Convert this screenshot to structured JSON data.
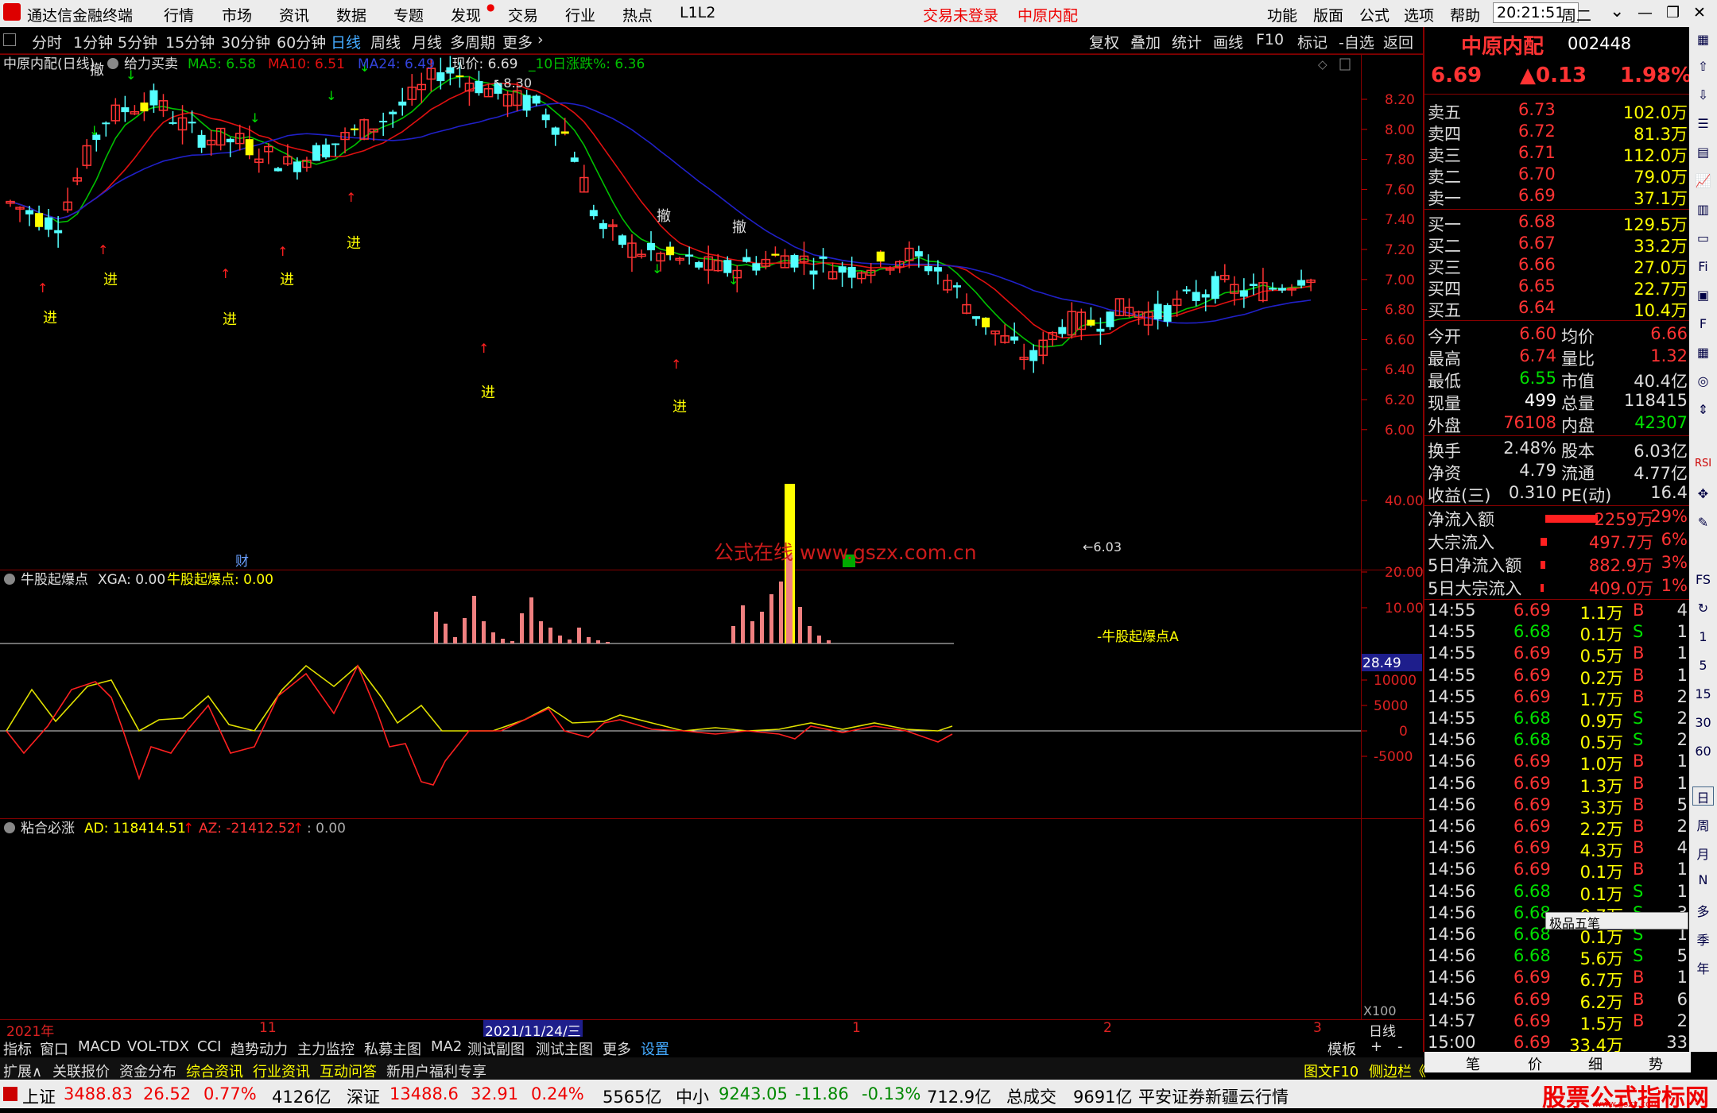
{
  "titlebar": {
    "app_name": "通达信金融终端",
    "menus": [
      "行情",
      "市场",
      "资讯",
      "数据",
      "专题",
      "发现",
      "交易",
      "行业",
      "热点",
      "L1L2"
    ],
    "trade_status": "交易未登录",
    "stock_name": "中原内配",
    "right_menus": [
      "功能",
      "版面",
      "公式",
      "选项",
      "帮助"
    ],
    "time": "20:21:51",
    "weekday": "周二"
  },
  "tfbar": {
    "timeframes": [
      "分时",
      "1分钟",
      "5分钟",
      "15分钟",
      "30分钟",
      "60分钟",
      "日线",
      "周线",
      "月线",
      "多周期",
      "更多"
    ],
    "active": "日线",
    "tools": [
      "复权",
      "叠加",
      "统计",
      "画线",
      "F10",
      "标记",
      "-自选",
      "返回"
    ]
  },
  "chart_header": {
    "name": "中原内配(日线)",
    "mode": "给力买卖",
    "ma5": "MA5: 6.58",
    "ma10": "MA10: 6.51",
    "ma24": "MA24: 6.49",
    "price": "_现价: 6.69",
    "pct": "_10日涨跌%: 6.36"
  },
  "main_chart": {
    "y_ticks": [
      "8.20",
      "8.00",
      "7.80",
      "7.60",
      "7.40",
      "7.20",
      "7.00",
      "6.80",
      "6.60",
      "6.40",
      "6.20",
      "6.00"
    ],
    "high_label": "8.30",
    "low_label": "6.03",
    "signal_buy": "进",
    "signal_cancel": "撤",
    "event_cai": "财",
    "watermark": "公式在线 www.gszx.com.cn"
  },
  "sub1": {
    "title": "牛股起爆点",
    "xga": "XGA: 0.00",
    "value": "牛股起爆点: 0.00",
    "y_ticks": [
      "40.00",
      "20.00",
      "10.00"
    ],
    "cursor_value": "28.49",
    "annotation": "牛股起爆点A"
  },
  "sub2": {
    "title": "粘合必涨",
    "ad": "AD: 118414.51",
    "az": "AZ: -21412.52",
    "zero": ": 0.00",
    "y_ticks": [
      "10000",
      "5000",
      "0",
      "-5000"
    ],
    "scale": "X100"
  },
  "time_axis": {
    "labels": [
      "2021年",
      "11",
      "2021/11/24/三",
      "1",
      "2",
      "3"
    ],
    "period": "日线"
  },
  "bottomtabs": [
    "指标",
    "窗口",
    "MACD",
    "VOL-TDX",
    "CCI",
    "趋势动力",
    "主力监控",
    "私募主图",
    "MA2",
    "测试副图",
    "测试主图",
    "更多",
    "设置"
  ],
  "bottomtabs_right": [
    "模板",
    "+",
    "-"
  ],
  "extbar": {
    "items": [
      "扩展∧",
      "关联报价",
      "资金分布",
      "综合资讯",
      "行业资讯",
      "互动问答",
      "新用户福利专享"
    ],
    "right": [
      "图文F10",
      "侧边栏《",
      "笔",
      "价",
      "细",
      "势"
    ]
  },
  "quote": {
    "name": "中原内配",
    "code": "002448",
    "price": "6.69",
    "change": "▲0.13",
    "pct": "1.98%",
    "sell": [
      [
        "卖五",
        "6.73",
        "102.0万"
      ],
      [
        "卖四",
        "6.72",
        "81.3万"
      ],
      [
        "卖三",
        "6.71",
        "112.0万"
      ],
      [
        "卖二",
        "6.70",
        "79.0万"
      ],
      [
        "卖一",
        "6.69",
        "37.1万"
      ]
    ],
    "buy": [
      [
        "买一",
        "6.68",
        "129.5万"
      ],
      [
        "买二",
        "6.67",
        "33.2万"
      ],
      [
        "买三",
        "6.66",
        "27.0万"
      ],
      [
        "买四",
        "6.65",
        "22.7万"
      ],
      [
        "买五",
        "6.64",
        "10.4万"
      ]
    ],
    "stats": [
      [
        "今开",
        "6.60",
        "均价",
        "6.66"
      ],
      [
        "最高",
        "6.74",
        "量比",
        "1.32"
      ],
      [
        "最低",
        "6.55",
        "市值",
        "40.4亿"
      ],
      [
        "现量",
        "499",
        "总量",
        "118415"
      ],
      [
        "外盘",
        "76108",
        "内盘",
        "42307"
      ]
    ],
    "stats2": [
      [
        "换手",
        "2.48%",
        "股本",
        "6.03亿"
      ],
      [
        "净资",
        "4.79",
        "流通",
        "4.77亿"
      ],
      [
        "收益(三)",
        "0.310",
        "PE(动)",
        "16.4"
      ]
    ],
    "flow": [
      [
        "净流入额",
        "2259万",
        "29%"
      ],
      [
        "大宗流入",
        "497.7万",
        "6%"
      ],
      [
        "5日净流入额",
        "882.9万",
        "3%"
      ],
      [
        "5日大宗流入",
        "409.0万",
        "1%"
      ]
    ],
    "ticks": [
      [
        "14:55",
        "6.69",
        "1.1万",
        "B",
        "4"
      ],
      [
        "14:55",
        "6.68",
        "0.1万",
        "S",
        "1"
      ],
      [
        "14:55",
        "6.69",
        "0.5万",
        "B",
        "1"
      ],
      [
        "14:55",
        "6.69",
        "0.2万",
        "B",
        "1"
      ],
      [
        "14:55",
        "6.69",
        "1.7万",
        "B",
        "2"
      ],
      [
        "14:55",
        "6.68",
        "0.9万",
        "S",
        "2"
      ],
      [
        "14:56",
        "6.68",
        "0.5万",
        "S",
        "2"
      ],
      [
        "14:56",
        "6.69",
        "1.0万",
        "B",
        "1"
      ],
      [
        "14:56",
        "6.69",
        "1.3万",
        "B",
        "1"
      ],
      [
        "14:56",
        "6.69",
        "3.3万",
        "B",
        "5"
      ],
      [
        "14:56",
        "6.69",
        "2.2万",
        "B",
        "2"
      ],
      [
        "14:56",
        "6.69",
        "4.3万",
        "B",
        "4"
      ],
      [
        "14:56",
        "6.69",
        "0.1万",
        "B",
        "1"
      ],
      [
        "14:56",
        "6.68",
        "0.1万",
        "S",
        "1"
      ],
      [
        "14:56",
        "6.68",
        "0.7万",
        "S",
        "3"
      ],
      [
        "14:56",
        "6.68",
        "0.1万",
        "S",
        "1"
      ],
      [
        "14:56",
        "6.68",
        "5.6万",
        "S",
        "5"
      ],
      [
        "14:56",
        "6.69",
        "6.7万",
        "B",
        "1"
      ],
      [
        "14:56",
        "6.69",
        "6.2万",
        "B",
        "6"
      ],
      [
        "14:57",
        "6.69",
        "1.5万",
        "B",
        "2"
      ],
      [
        "15:00",
        "6.69",
        "33.4万",
        "",
        "33"
      ]
    ],
    "popup": "极品五笔"
  },
  "sidetools": [
    "日",
    "周",
    "月",
    "N",
    "多",
    "季",
    "年"
  ],
  "statusbar": {
    "sh_name": "上证",
    "sh": "3488.83",
    "sh_chg": "26.52",
    "sh_pct": "0.77%",
    "sh_amt": "4126亿",
    "sz_name": "深证",
    "sz": "13488.6",
    "sz_chg": "32.91",
    "sz_pct": "0.24%",
    "sz_amt": "5565亿",
    "zx_name": "中小",
    "zx": "9243.05",
    "zx_chg": "-11.86",
    "zx_pct": "-0.13%",
    "zx_amt": "712.9亿",
    "total_label": "总成交",
    "total": "9691亿",
    "broker": "平安证券新疆云行情",
    "logo": "股票公式指标网",
    "logo_url": "www.gszx.com"
  },
  "colors": {
    "up": "#ff3333",
    "down": "#54ffff",
    "ma5": "#00c000",
    "ma10": "#e01010",
    "ma24": "#2020c8",
    "accent": "#ffff00"
  }
}
